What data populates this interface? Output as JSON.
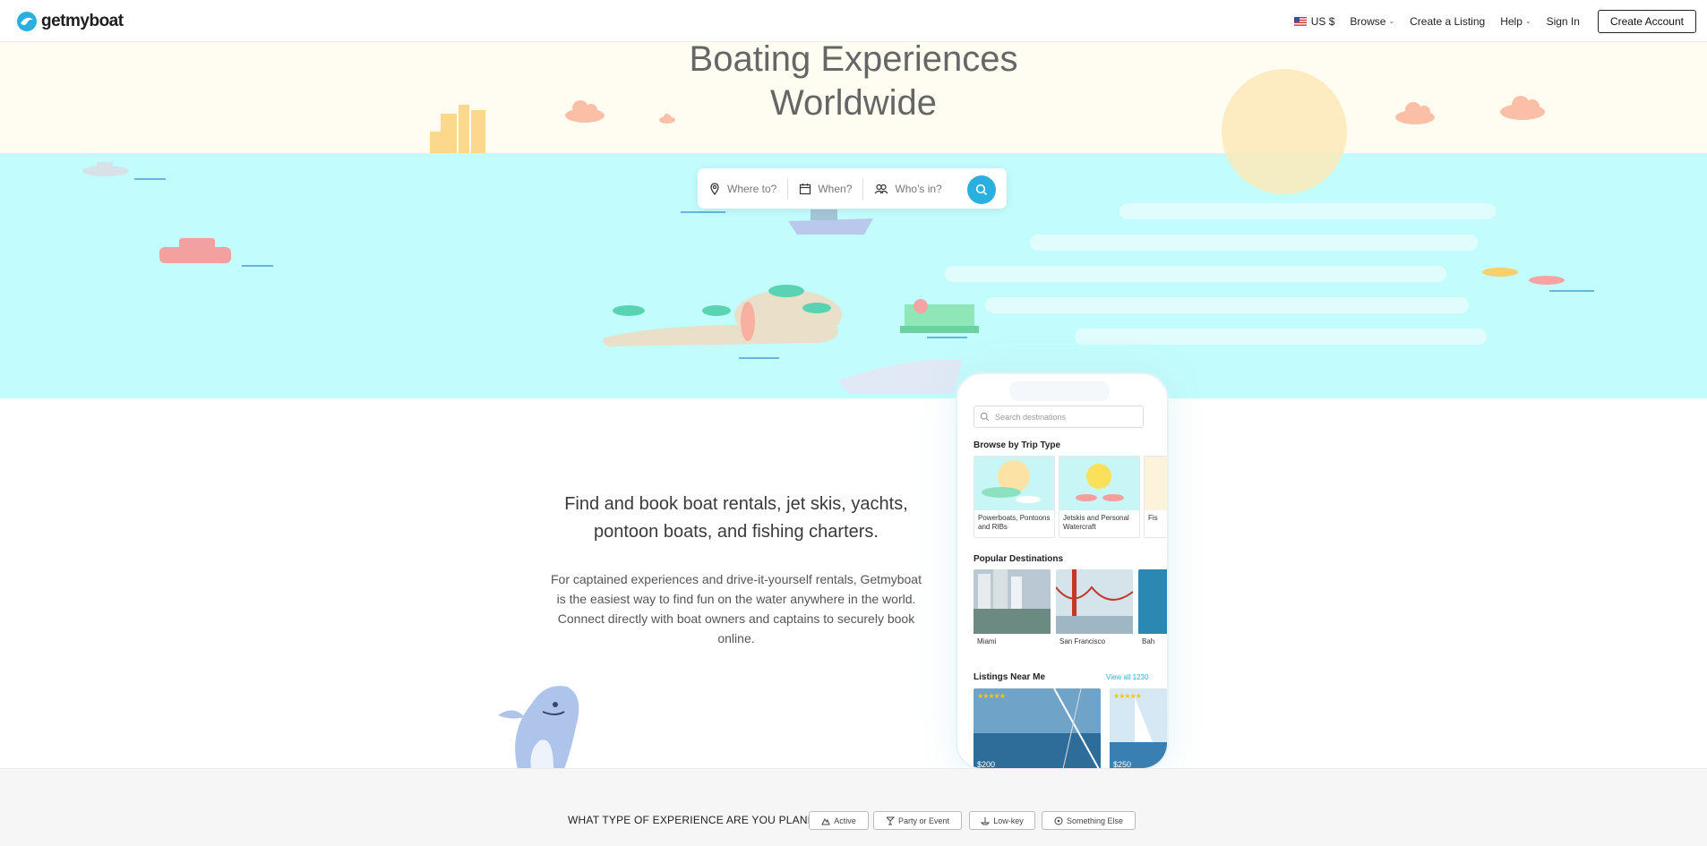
{
  "nav": {
    "logo": "getmyboat",
    "currency": "US $",
    "browse": "Browse",
    "create_listing": "Create a Listing",
    "help": "Help",
    "sign_in": "Sign In",
    "create_account": "Create Account"
  },
  "hero": {
    "title_line1": "Boating Experiences",
    "title_line2": "Worldwide",
    "search": {
      "where_placeholder": "Where to?",
      "when_placeholder": "When?",
      "who_placeholder": "Who's in?"
    }
  },
  "intro": {
    "lead": "Find and book boat rentals, jet skis, yachts, pontoon boats, and fishing charters.",
    "body": "For captained experiences and drive-it-yourself rentals, Getmyboat is the easiest way to find fun on the water anywhere in the world. Connect directly with boat owners and captains to securely book online."
  },
  "phone": {
    "search_placeholder": "Search destinations",
    "browse_heading": "Browse by Trip Type",
    "trip_types": [
      "Powerboats, Pontoons and RIBs",
      "Jetskis and Personal Watercraft",
      "Fis"
    ],
    "popular_heading": "Popular Destinations",
    "destinations": [
      "Miami",
      "San Francisco",
      "Bah"
    ],
    "listings_heading": "Listings Near Me",
    "view_all": "View all 1230",
    "listing_prices": [
      "$200",
      "$250"
    ]
  },
  "experience": {
    "question": "WHAT TYPE OF EXPERIENCE ARE YOU PLANNING?",
    "options": [
      "Active",
      "Party or Event",
      "Low-key",
      "Something Else"
    ]
  },
  "colors": {
    "accent": "#2ab0e0",
    "sea": "#c2fcfc",
    "sky": "#fffdf2"
  }
}
